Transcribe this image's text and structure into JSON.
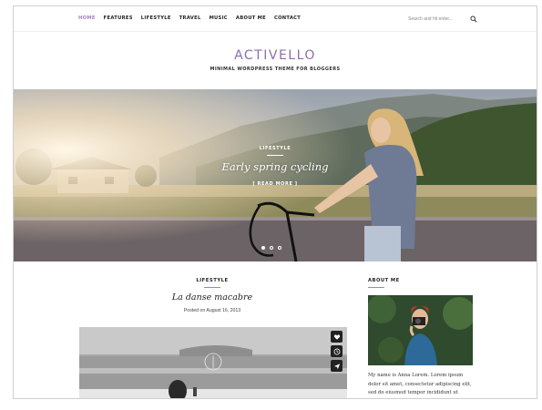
{
  "nav": {
    "items": [
      {
        "label": "HOME",
        "active": true
      },
      {
        "label": "FEATURES",
        "active": false
      },
      {
        "label": "LIFESTYLE",
        "active": false
      },
      {
        "label": "TRAVEL",
        "active": false
      },
      {
        "label": "MUSIC",
        "active": false
      },
      {
        "label": "ABOUT ME",
        "active": false
      },
      {
        "label": "CONTACT",
        "active": false
      }
    ],
    "search_placeholder": "Search and hit enter...",
    "search_icon": "search-icon"
  },
  "brand": {
    "logo": "ACTIVELLO",
    "tagline": "MINIMAL WORDPRESS THEME FOR BLOGGERS"
  },
  "hero": {
    "category": "LIFESTYLE",
    "title": "Early spring cycling",
    "read_more": "[ READ MORE ]",
    "slide_count": 3,
    "active_slide": 1
  },
  "post": {
    "category": "LIFESTYLE",
    "title": "La danse macabre",
    "meta": "Posted on August 16, 2013",
    "share_icons": [
      "heart-icon",
      "clock-icon",
      "send-icon"
    ]
  },
  "sidebar": {
    "about_title": "ABOUT ME",
    "about_text": "My name is Anna Lorem. Lorem ipsum dolor sit amet, consectetur adipiscing elit, sed do eiusmod tempor incididunt ut"
  },
  "colors": {
    "accent": "#a37fc9",
    "logo": "#8b6fb0",
    "text": "#222222"
  }
}
